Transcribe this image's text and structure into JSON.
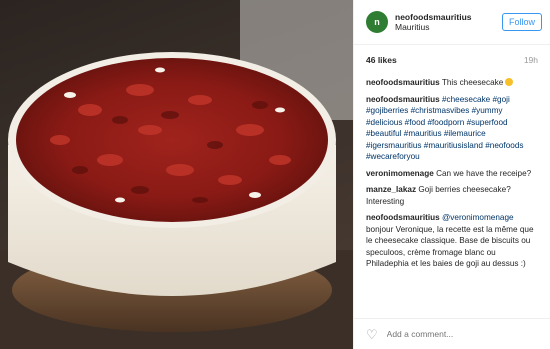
{
  "header": {
    "username": "neofoodsmauritius",
    "location": "Mauritius",
    "follow_label": "Follow"
  },
  "meta": {
    "likes": "46 likes",
    "time": "19h"
  },
  "comments": [
    {
      "user": "neofoodsmauritius",
      "text": "This cheesecake"
    },
    {
      "user": "neofoodsmauritius",
      "text": "#cheesecake #goji #gojiberries #christmasvibes #yummy #delicious #food #foodporn #superfood #beautiful #mauritius #ilemaurice #igersmauritius #mauritiusisland #neofoods #wecareforyou"
    },
    {
      "user": "veronimomenage",
      "text": "Can we have the receipe?"
    },
    {
      "user": "manze_lakaz",
      "text": "Goji berries cheesecake? Interesting"
    },
    {
      "user": "neofoodsmauritius",
      "mention": "@veronimomenage",
      "text": "bonjour Veronique, la recette est la même que le cheesecake classique. Base de biscuits ou speculoos, crème fromage blanc ou Philadephia et les baies de goji au dessus :)"
    }
  ],
  "add_comment": {
    "placeholder": "Add a comment..."
  },
  "colors": {
    "link": "#3897f0",
    "hashtag": "#003569",
    "avatar": "#2e7d32"
  },
  "icons": [
    "heart-icon",
    "avatar-logo"
  ]
}
